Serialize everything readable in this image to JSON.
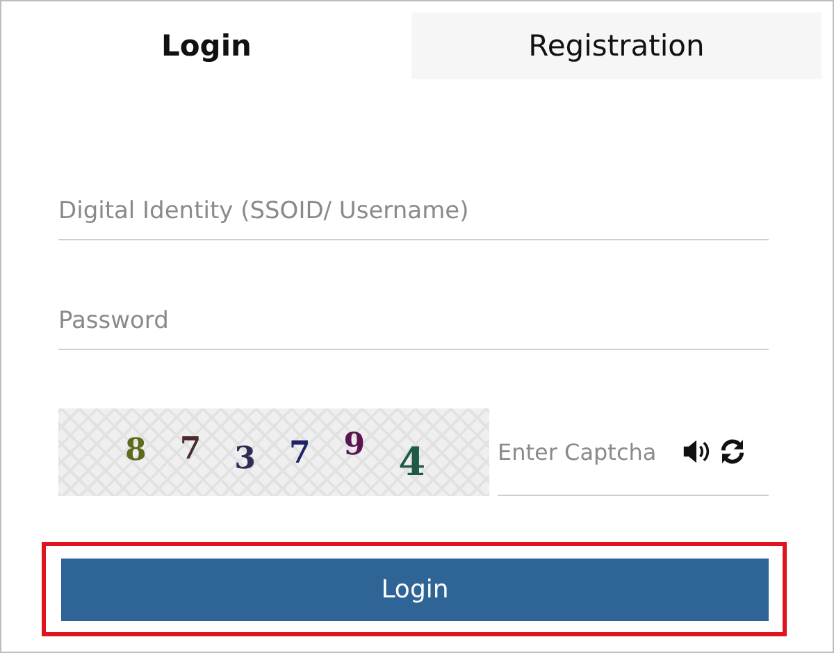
{
  "tabs": [
    {
      "label": "Login",
      "selected": true
    },
    {
      "label": "Registration",
      "selected": false
    }
  ],
  "username": {
    "placeholder": "Digital Identity (SSOID/ Username)"
  },
  "password": {
    "placeholder": "Password"
  },
  "captcha": {
    "digits": [
      {
        "text": "8",
        "color": "#5c6b1c"
      },
      {
        "text": "7",
        "color": "#4a2a2a"
      },
      {
        "text": "3",
        "color": "#2c2c55"
      },
      {
        "text": "7",
        "color": "#1f2366"
      },
      {
        "text": "9",
        "color": "#5a1550"
      },
      {
        "text": "4",
        "color": "#1f5a48"
      }
    ],
    "placeholder": "Enter Captcha"
  },
  "login_button": {
    "label": "Login",
    "highlighted": true
  }
}
